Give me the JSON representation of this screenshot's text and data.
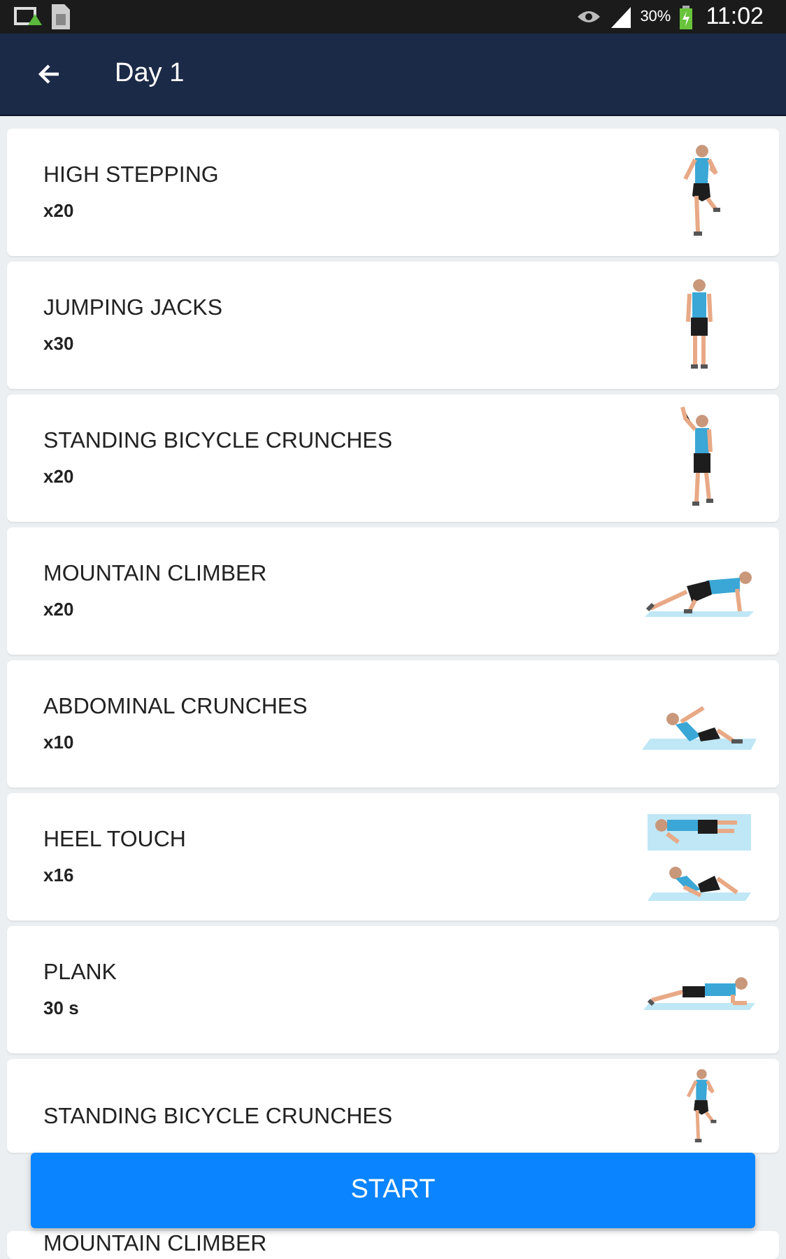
{
  "status_bar": {
    "battery": "30%",
    "time": "11:02"
  },
  "app_bar": {
    "title": "Day 1"
  },
  "exercises": [
    {
      "name": "HIGH STEPPING",
      "reps": "x20",
      "kind": "knee-raise"
    },
    {
      "name": "JUMPING JACKS",
      "reps": "x30",
      "kind": "standing"
    },
    {
      "name": "STANDING BICYCLE CRUNCHES",
      "reps": "x20",
      "kind": "arm-raise"
    },
    {
      "name": "MOUNTAIN CLIMBER",
      "reps": "x20",
      "kind": "crawl"
    },
    {
      "name": "ABDOMINAL CRUNCHES",
      "reps": "x10",
      "kind": "crunch"
    },
    {
      "name": "HEEL TOUCH",
      "reps": "x16",
      "kind": "double"
    },
    {
      "name": "PLANK",
      "reps": "30 s",
      "kind": "plank"
    },
    {
      "name": "STANDING BICYCLE CRUNCHES",
      "kind": "knee-raise"
    },
    {
      "name": "MOUNTAIN CLIMBER",
      "kind": "none"
    }
  ],
  "start_button": {
    "label": "START"
  }
}
